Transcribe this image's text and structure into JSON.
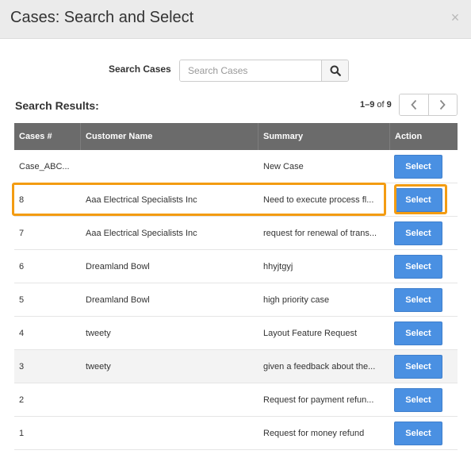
{
  "modal": {
    "title": "Cases: Search and Select",
    "close_glyph": "×"
  },
  "search": {
    "label": "Search Cases",
    "placeholder": "Search Cases",
    "value": ""
  },
  "results": {
    "title": "Search Results:",
    "range": "1–9",
    "of_label": "of",
    "total": "9"
  },
  "table": {
    "headers": [
      "Cases #",
      "Customer Name",
      "Summary",
      "Action"
    ],
    "rows": [
      {
        "case": "Case_ABC...",
        "customer": "",
        "summary": "New Case",
        "action": "Select"
      },
      {
        "case": "8",
        "customer": "Aaa Electrical Specialists Inc",
        "summary": "Need to execute process fl...",
        "action": "Select"
      },
      {
        "case": "7",
        "customer": "Aaa Electrical Specialists Inc",
        "summary": "request for renewal of trans...",
        "action": "Select"
      },
      {
        "case": "6",
        "customer": "Dreamland Bowl",
        "summary": "hhyjtgyj",
        "action": "Select"
      },
      {
        "case": "5",
        "customer": "Dreamland Bowl",
        "summary": "high priority case",
        "action": "Select"
      },
      {
        "case": "4",
        "customer": "tweety",
        "summary": "Layout Feature Request",
        "action": "Select"
      },
      {
        "case": "3",
        "customer": "tweety",
        "summary": "given a feedback about the...",
        "action": "Select"
      },
      {
        "case": "2",
        "customer": "",
        "summary": "Request for payment refun...",
        "action": "Select"
      },
      {
        "case": "1",
        "customer": "",
        "summary": "Request for money refund",
        "action": "Select"
      }
    ]
  },
  "icons": {
    "search": "search-icon",
    "prev": "chevron-left-icon",
    "next": "chevron-right-icon",
    "close": "close-icon"
  },
  "colors": {
    "header_bg": "#6b6b6b",
    "select_button": "#4a90e2",
    "highlight": "#f39c12"
  }
}
